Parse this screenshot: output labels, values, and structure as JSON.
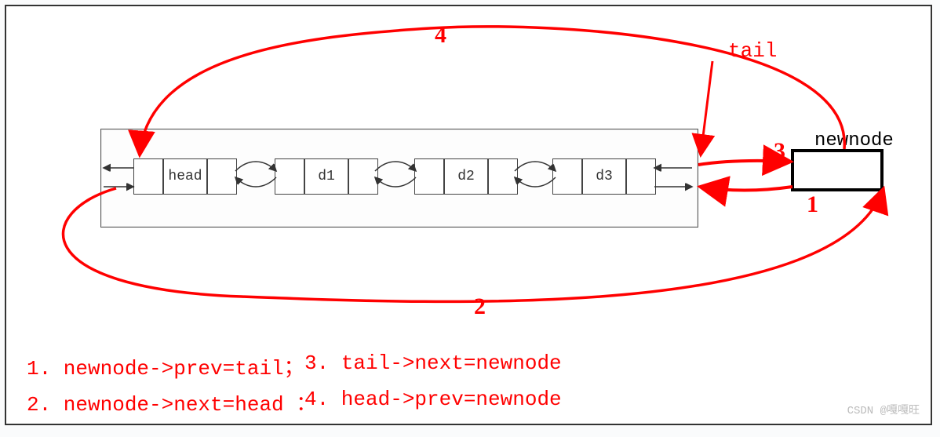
{
  "nodes": {
    "head": "head",
    "d1": "d1",
    "d2": "d2",
    "d3": "d3"
  },
  "newnode_label": "newnode",
  "tail_label": "tail",
  "nums": {
    "n1": "1",
    "n2": "2",
    "n3": "3",
    "n4": "4"
  },
  "steps": {
    "s1": "1. newnode->prev=tail；",
    "s2": "2. newnode->next=head ：",
    "s3": "3. tail->next=newnode",
    "s4": "4. head->prev=newnode"
  },
  "watermark": "CSDN @嘎嘎旺"
}
